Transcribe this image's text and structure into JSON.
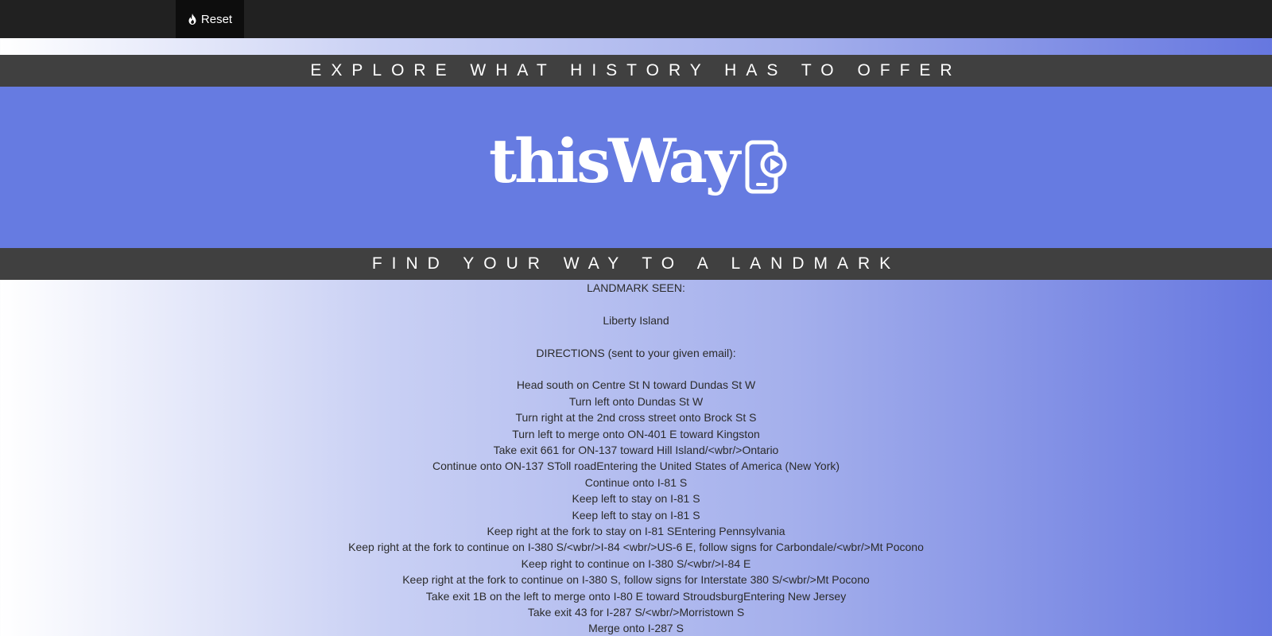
{
  "navbar": {
    "reset_label": "Reset",
    "reset_icon": "fire-icon"
  },
  "banners": {
    "top": "EXPLORE WHAT HISTORY HAS TO OFFER",
    "bottom": "FIND YOUR WAY TO A LANDMARK"
  },
  "logo": {
    "text": "thisWay",
    "icon": "phone-play-icon"
  },
  "result": {
    "landmark_heading": "LANDMARK SEEN:",
    "landmark_name": "Liberty Island",
    "directions_heading": "DIRECTIONS (sent to your given email):",
    "directions": [
      "Head south on Centre St N toward Dundas St W",
      "Turn left onto Dundas St W",
      "Turn right at the 2nd cross street onto Brock St S",
      "Turn left to merge onto ON-401 E toward Kingston",
      "Take exit 661 for ON-137 toward Hill Island/<wbr/>Ontario",
      "Continue onto ON-137 SToll roadEntering the United States of America (New York)",
      "Continue onto I-81 S",
      "Keep left to stay on I-81 S",
      "Keep left to stay on I-81 S",
      "Keep right at the fork to stay on I-81 SEntering Pennsylvania",
      "Keep right at the fork to continue on I-380 S/<wbr/>I-84 <wbr/>US-6 E, follow signs for Carbondale/<wbr/>Mt Pocono",
      "Keep right to continue on I-380 S/<wbr/>I-84 E",
      "Keep right at the fork to continue on I-380 S, follow signs for Interstate 380 S/<wbr/>Mt Pocono",
      "Take exit 1B on the left to merge onto I-80 E toward StroudsburgEntering New Jersey",
      "Take exit 43 for I-287 S/<wbr/>Morristown S",
      "Merge onto I-287 S"
    ]
  },
  "colors": {
    "navbar": "#212121",
    "reset_button": "#0d0d0d",
    "banner": "#404040",
    "hero": "#667be1",
    "gradient_end": "#6677e0"
  }
}
